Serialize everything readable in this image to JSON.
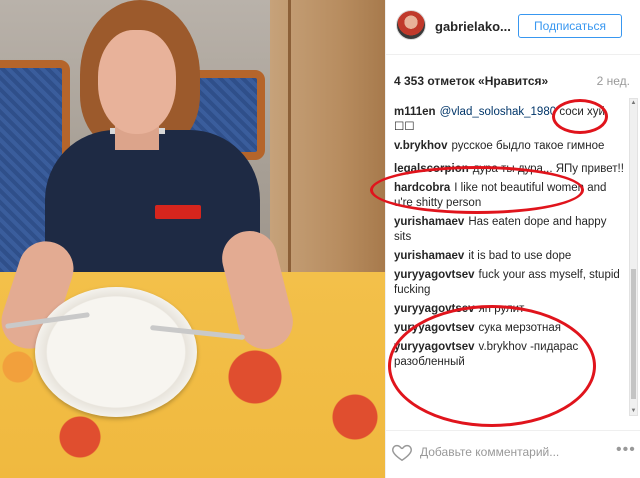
{
  "header": {
    "username": "gabrielako...",
    "follow_label": "Подписаться"
  },
  "stats": {
    "likes": "4 353 отметок «Нравится»",
    "time_ago": "2 нед."
  },
  "comments": [
    {
      "user": "m111en",
      "mention": "@vlad_soloshak_1980",
      "text": " соси хуй ☐☐"
    },
    {
      "user": "v.brykhov",
      "mention": "",
      "text": "русское быдло такое гимное"
    },
    {
      "user": "legalscorpion",
      "mention": "",
      "text": "дура ты дура... ЯПу привет!!"
    },
    {
      "user": "hardcobra",
      "mention": "",
      "text": "I like not beautiful women and u're shitty person"
    },
    {
      "user": "yurishamaev",
      "mention": "",
      "text": "Has eaten dope and happy sits"
    },
    {
      "user": "yurishamaev",
      "mention": "",
      "text": "it is bad to use dope"
    },
    {
      "user": "yuryyagovtsev",
      "mention": "",
      "text": "fuck your ass myself, stupid fucking"
    },
    {
      "user": "yuryyagovtsev",
      "mention": "",
      "text": "яп рулит"
    },
    {
      "user": "yuryyagovtsev",
      "mention": "",
      "text": "сука мерзотная"
    },
    {
      "user": "yuryyagovtsev",
      "mention": "",
      "text": "v.brykhov -пидарас разобленный"
    }
  ],
  "footer": {
    "comment_placeholder": "Добавьте комментарий...",
    "more_icon": "•••"
  },
  "icons": {
    "heart": "heart-icon",
    "more": "more-icon"
  },
  "colors": {
    "follow_blue": "#3897f0",
    "annotation_red": "#e0141c"
  }
}
